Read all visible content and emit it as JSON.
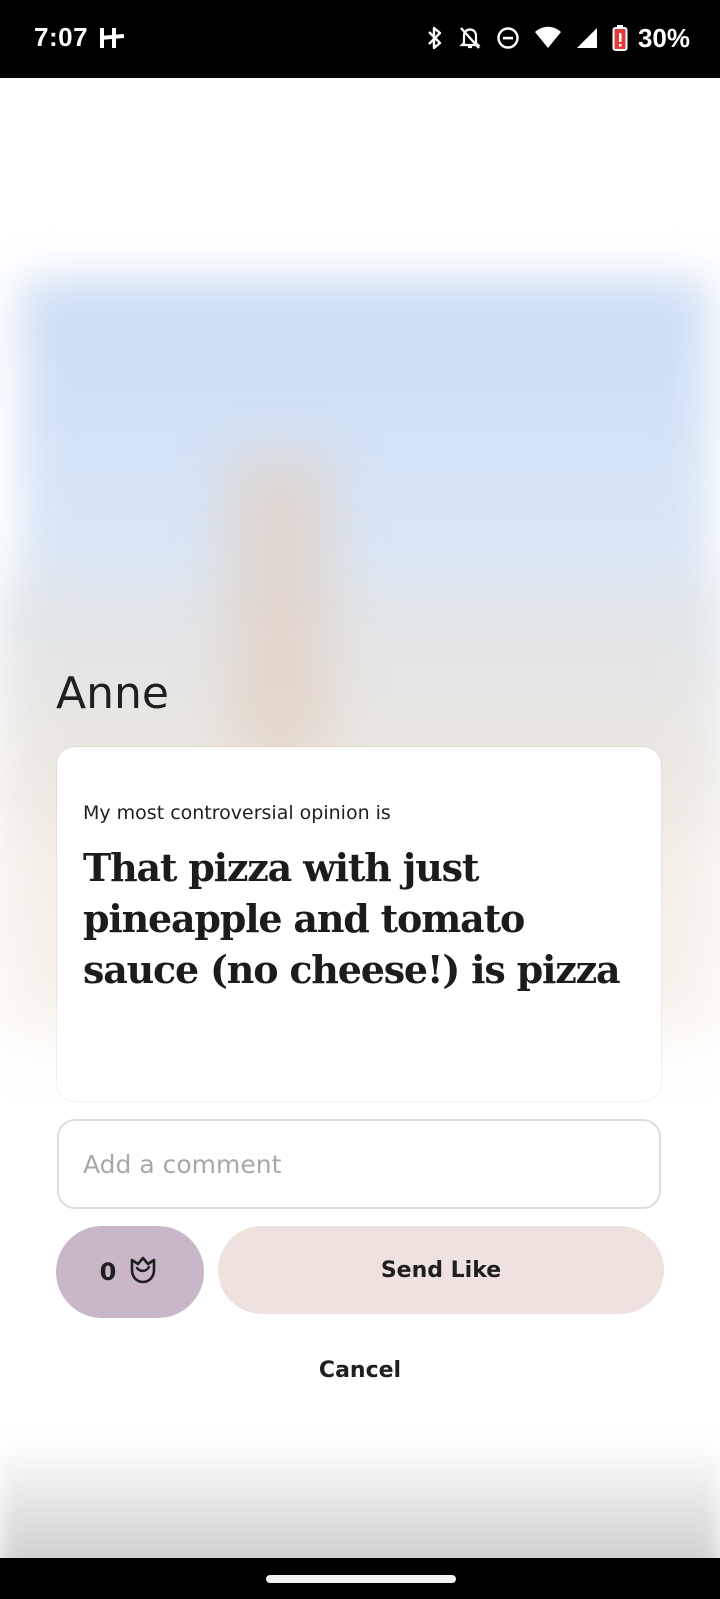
{
  "status_bar": {
    "time": "7:07",
    "battery_percent": "30%",
    "icons": [
      "hinge-notification-icon",
      "bluetooth-icon",
      "notifications-off-icon",
      "do-not-disturb-icon",
      "wifi-icon",
      "cellular-signal-icon",
      "battery-low-icon"
    ]
  },
  "profile": {
    "name": "Anne"
  },
  "prompt": {
    "question": "My most controversial opinion is",
    "answer": "That pizza with just pineapple and tomato sauce (no cheese!)  is  pizza"
  },
  "comment": {
    "placeholder": "Add a comment",
    "value": ""
  },
  "rose": {
    "count": "0",
    "icon": "rose-icon"
  },
  "actions": {
    "send_like_label": "Send Like",
    "cancel_label": "Cancel"
  },
  "colors": {
    "rose_button": "#c9b7c9",
    "send_like_button": "#eee1de",
    "text": "#1f1f1f"
  }
}
